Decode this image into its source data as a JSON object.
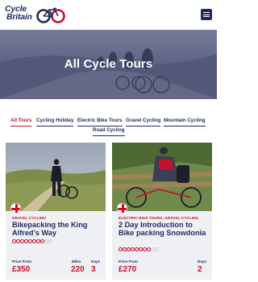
{
  "header": {
    "logo_line1": "Cycle",
    "logo_line2": "Britain",
    "menu_icon": "hamburger-menu-icon",
    "brand_navy": "#1f2a5c",
    "brand_red": "#c8102e"
  },
  "hero": {
    "title": "All Cycle Tours"
  },
  "tabs": [
    {
      "label": "All Tours",
      "active": true
    },
    {
      "label": "Cycling Holiday",
      "active": false
    },
    {
      "label": "Electric Bike Tours",
      "active": false
    },
    {
      "label": "Gravel Cycling",
      "active": false
    },
    {
      "label": "Mountain Cycling",
      "active": false
    },
    {
      "label": "Road Cycling",
      "active": false
    }
  ],
  "cards": [
    {
      "category": "GRAVEL CYCLING",
      "title": "Bikepacking the King Alfred’s Way",
      "rating": 4,
      "rating_max": 5,
      "price_label": "Price From",
      "price": "£350",
      "miles_label": "Miles",
      "miles": "220",
      "days_label": "Days",
      "days": "3"
    },
    {
      "category": "ELECTRIC BIKE TOURS, GRAVEL CYCLING",
      "title": "2 Day Introduction to Bike packing Snowdonia",
      "rating": 4,
      "rating_max": 5,
      "price_label": "Price From",
      "price": "£270",
      "days_label": "Days",
      "days": "2"
    }
  ]
}
